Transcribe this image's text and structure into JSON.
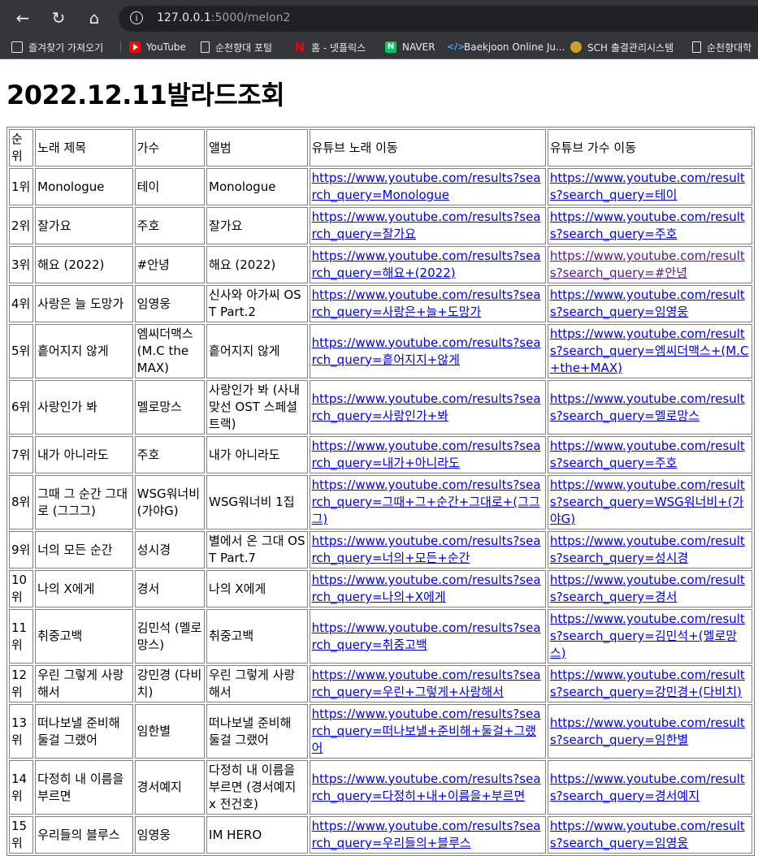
{
  "browser": {
    "url_host": "127.0.0.1",
    "url_path": ":5000/melon2",
    "bookmarks": [
      {
        "label": "즐겨찾기 가져오기",
        "icon": "import-icon"
      },
      {
        "label": "YouTube",
        "icon": "youtube-icon"
      },
      {
        "label": "순천향대 포털",
        "icon": "page-icon"
      },
      {
        "label": "홈 - 넷플릭스",
        "icon": "netflix-icon"
      },
      {
        "label": "NAVER",
        "icon": "naver-icon"
      },
      {
        "label": "Baekjoon Online Ju...",
        "icon": "code-icon"
      },
      {
        "label": "SCH 출결관리시스템",
        "icon": "sch-icon"
      },
      {
        "label": "순천향대학",
        "icon": "page-icon"
      }
    ]
  },
  "page": {
    "title": "2022.12.11발라드조회"
  },
  "table": {
    "headers": [
      "순위",
      "노래 제목",
      "가수",
      "앨범",
      "유튜브 노래 이동",
      "유튜브 가수 이동"
    ],
    "rows": [
      {
        "rank": "1위",
        "title": "Monologue",
        "artist": "테이",
        "album": "Monologue",
        "song_link": "https://www.youtube.com/results?search_query=Monologue",
        "artist_link": "https://www.youtube.com/results?search_query=테이"
      },
      {
        "rank": "2위",
        "title": "잘가요",
        "artist": "주호",
        "album": "잘가요",
        "song_link": "https://www.youtube.com/results?search_query=잘가요",
        "artist_link": "https://www.youtube.com/results?search_query=주호"
      },
      {
        "rank": "3위",
        "title": "해요 (2022)",
        "artist": "#안녕",
        "album": "해요 (2022)",
        "song_link": "https://www.youtube.com/results?search_query=해요+(2022)",
        "artist_link": "https://www.youtube.com/results?search_query=#안녕"
      },
      {
        "rank": "4위",
        "title": "사랑은 늘 도망가",
        "artist": "임영웅",
        "album": "신사와 아가씨 OST Part.2",
        "song_link": "https://www.youtube.com/results?search_query=사랑은+늘+도망가",
        "artist_link": "https://www.youtube.com/results?search_query=임영웅"
      },
      {
        "rank": "5위",
        "title": "흩어지지 않게",
        "artist": "엠씨더맥스 (M.C the MAX)",
        "album": "흩어지지 않게",
        "song_link": "https://www.youtube.com/results?search_query=흩어지지+않게",
        "artist_link": "https://www.youtube.com/results?search_query=엠씨더맥스+(M.C+the+MAX)"
      },
      {
        "rank": "6위",
        "title": "사랑인가 봐",
        "artist": "멜로망스",
        "album": "사랑인가 봐 (사내맞선 OST 스페셜 트랙)",
        "song_link": "https://www.youtube.com/results?search_query=사랑인가+봐",
        "artist_link": "https://www.youtube.com/results?search_query=멜로망스"
      },
      {
        "rank": "7위",
        "title": "내가 아니라도",
        "artist": "주호",
        "album": "내가 아니라도",
        "song_link": "https://www.youtube.com/results?search_query=내가+아니라도",
        "artist_link": "https://www.youtube.com/results?search_query=주호"
      },
      {
        "rank": "8위",
        "title": "그때 그 순간 그대로 (그그그)",
        "artist": "WSG워너비 (가야G)",
        "album": "WSG워너비 1집",
        "song_link": "https://www.youtube.com/results?search_query=그때+그+순간+그대로+(그그그)",
        "artist_link": "https://www.youtube.com/results?search_query=WSG워너비+(가야G)"
      },
      {
        "rank": "9위",
        "title": "너의 모든 순간",
        "artist": "성시경",
        "album": "별에서 온 그대 OST Part.7",
        "song_link": "https://www.youtube.com/results?search_query=너의+모든+순간",
        "artist_link": "https://www.youtube.com/results?search_query=성시경"
      },
      {
        "rank": "10위",
        "title": "나의 X에게",
        "artist": "경서",
        "album": "나의 X에게",
        "song_link": "https://www.youtube.com/results?search_query=나의+X에게",
        "artist_link": "https://www.youtube.com/results?search_query=경서"
      },
      {
        "rank": "11위",
        "title": "취중고백",
        "artist": "김민석 (멜로망스)",
        "album": "취중고백",
        "song_link": "https://www.youtube.com/results?search_query=취중고백",
        "artist_link": "https://www.youtube.com/results?search_query=김민석+(멜로망스)"
      },
      {
        "rank": "12위",
        "title": "우린 그렇게 사랑해서",
        "artist": "강민경 (다비치)",
        "album": "우린 그렇게 사랑해서",
        "song_link": "https://www.youtube.com/results?search_query=우린+그렇게+사랑해서",
        "artist_link": "https://www.youtube.com/results?search_query=강민경+(다비치)"
      },
      {
        "rank": "13위",
        "title": "떠나보낼 준비해 둘걸 그랬어",
        "artist": "임한별",
        "album": "떠나보낼 준비해 둘걸 그랬어",
        "song_link": "https://www.youtube.com/results?search_query=떠나보낼+준비해+둘걸+그랬어",
        "artist_link": "https://www.youtube.com/results?search_query=임한별"
      },
      {
        "rank": "14위",
        "title": "다정히 내 이름을 부르면",
        "artist": "경서예지",
        "album": "다정히 내 이름을 부르면 (경서예지 x 전건호)",
        "song_link": "https://www.youtube.com/results?search_query=다정히+내+이름을+부르면",
        "artist_link": "https://www.youtube.com/results?search_query=경서예지"
      },
      {
        "rank": "15위",
        "title": "우리들의 블루스",
        "artist": "임영웅",
        "album": "IM HERO",
        "song_link": "https://www.youtube.com/results?search_query=우리들의+블루스",
        "artist_link": "https://www.youtube.com/results?search_query=임영웅"
      }
    ]
  }
}
